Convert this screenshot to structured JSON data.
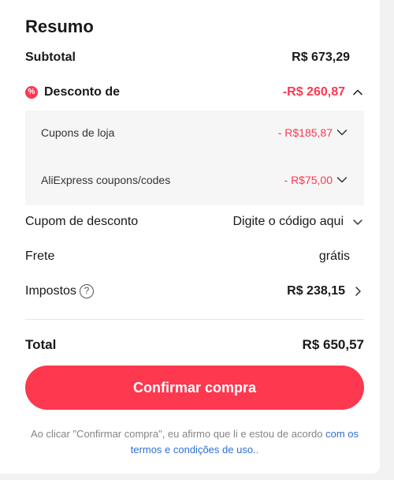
{
  "summary": {
    "title": "Resumo",
    "subtotal_label": "Subtotal",
    "subtotal_value": "R$ 673,29",
    "discount_label": "Desconto de",
    "discount_value": "-R$ 260,87",
    "discount_icon": "%",
    "discount_items": [
      {
        "label": "Cupons de loja",
        "value": "- R$185,87"
      },
      {
        "label": "AliExpress coupons/codes",
        "value": "- R$75,00"
      }
    ],
    "coupon_label": "Cupom de desconto",
    "coupon_placeholder": "Digite o código aqui",
    "shipping_label": "Frete",
    "shipping_value": "grátis",
    "taxes_label": "Impostos",
    "taxes_help_icon": "?",
    "taxes_value": "R$ 238,15",
    "total_label": "Total",
    "total_value": "R$ 650,57"
  },
  "confirm_button_label": "Confirmar compra",
  "legal": {
    "text": "Ao clicar \"Confirmar compra\", eu afirmo que li e estou de acordo ",
    "link_text": "com os termos e condições de uso.",
    "suffix": "."
  },
  "colors": {
    "accent": "#fd384f",
    "link": "#2f6fd6",
    "muted_text": "#858585",
    "page_background": "#f2f2f2"
  }
}
